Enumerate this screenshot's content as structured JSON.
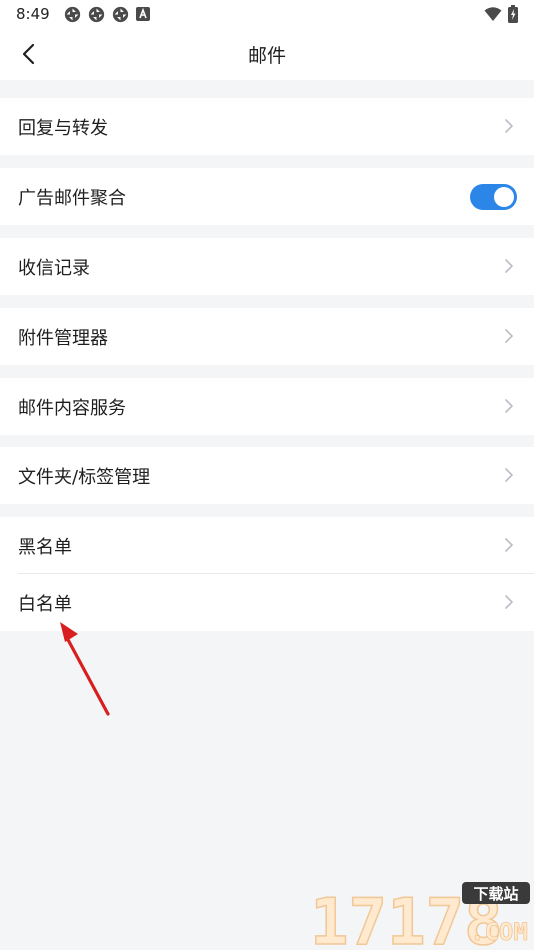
{
  "status": {
    "time": "8:49",
    "left_icons": [
      "sync-icon",
      "sync-icon",
      "sync-icon",
      "a-icon"
    ],
    "right_icons": [
      "wifi-icon",
      "battery-icon"
    ]
  },
  "header": {
    "title": "邮件",
    "back_icon": "chevron-left-icon"
  },
  "settings": {
    "reply_forward": "回复与转发",
    "ad_aggregation": "广告邮件聚合",
    "ad_aggregation_enabled": true,
    "receive_log": "收信记录",
    "attachment_manager": "附件管理器",
    "mail_content_service": "邮件内容服务",
    "folder_tag_manage": "文件夹/标签管理",
    "blacklist": "黑名单",
    "whitelist": "白名单"
  },
  "watermark": {
    "number": "17178",
    "badge": "下载站",
    "domain": ".COM"
  },
  "colors": {
    "accent": "#2b86e8",
    "background": "#f4f5f7",
    "annotation_arrow": "#d81e1e"
  }
}
